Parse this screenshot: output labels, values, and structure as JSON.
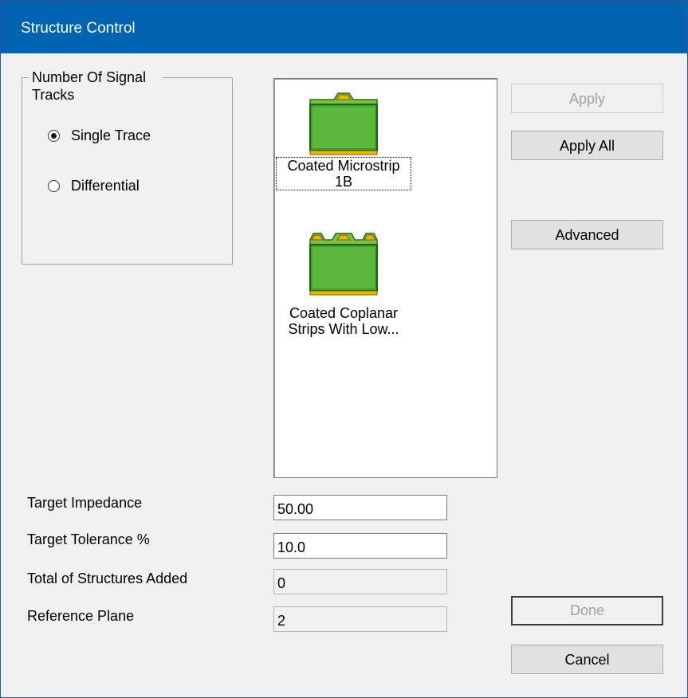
{
  "window": {
    "title": "Structure Control"
  },
  "signal_tracks": {
    "legend": "Number Of Signal Tracks",
    "options": [
      {
        "label": "Single Trace",
        "checked": true
      },
      {
        "label": "Differential",
        "checked": false
      }
    ]
  },
  "structures": [
    {
      "caption": "Coated Microstrip 1B",
      "icon": "coated-microstrip-icon",
      "focused": true
    },
    {
      "caption": "Coated Coplanar Strips With Low...",
      "icon": "coated-coplanar-strips-icon",
      "focused": false
    }
  ],
  "buttons": {
    "apply": "Apply",
    "apply_all": "Apply All",
    "advanced": "Advanced",
    "done": "Done",
    "cancel": "Cancel"
  },
  "fields": {
    "target_impedance": {
      "label": "Target Impedance",
      "value": "50.00"
    },
    "target_tolerance": {
      "label": "Target Tolerance %",
      "value": "10.0"
    },
    "total_structures": {
      "label": "Total of Structures Added",
      "value": "0"
    },
    "reference_plane": {
      "label": "Reference Plane",
      "value": "2"
    }
  },
  "colors": {
    "titlebar": "#0063b1",
    "dielectric": "#3f9f2f",
    "copper": "#e6b800"
  }
}
